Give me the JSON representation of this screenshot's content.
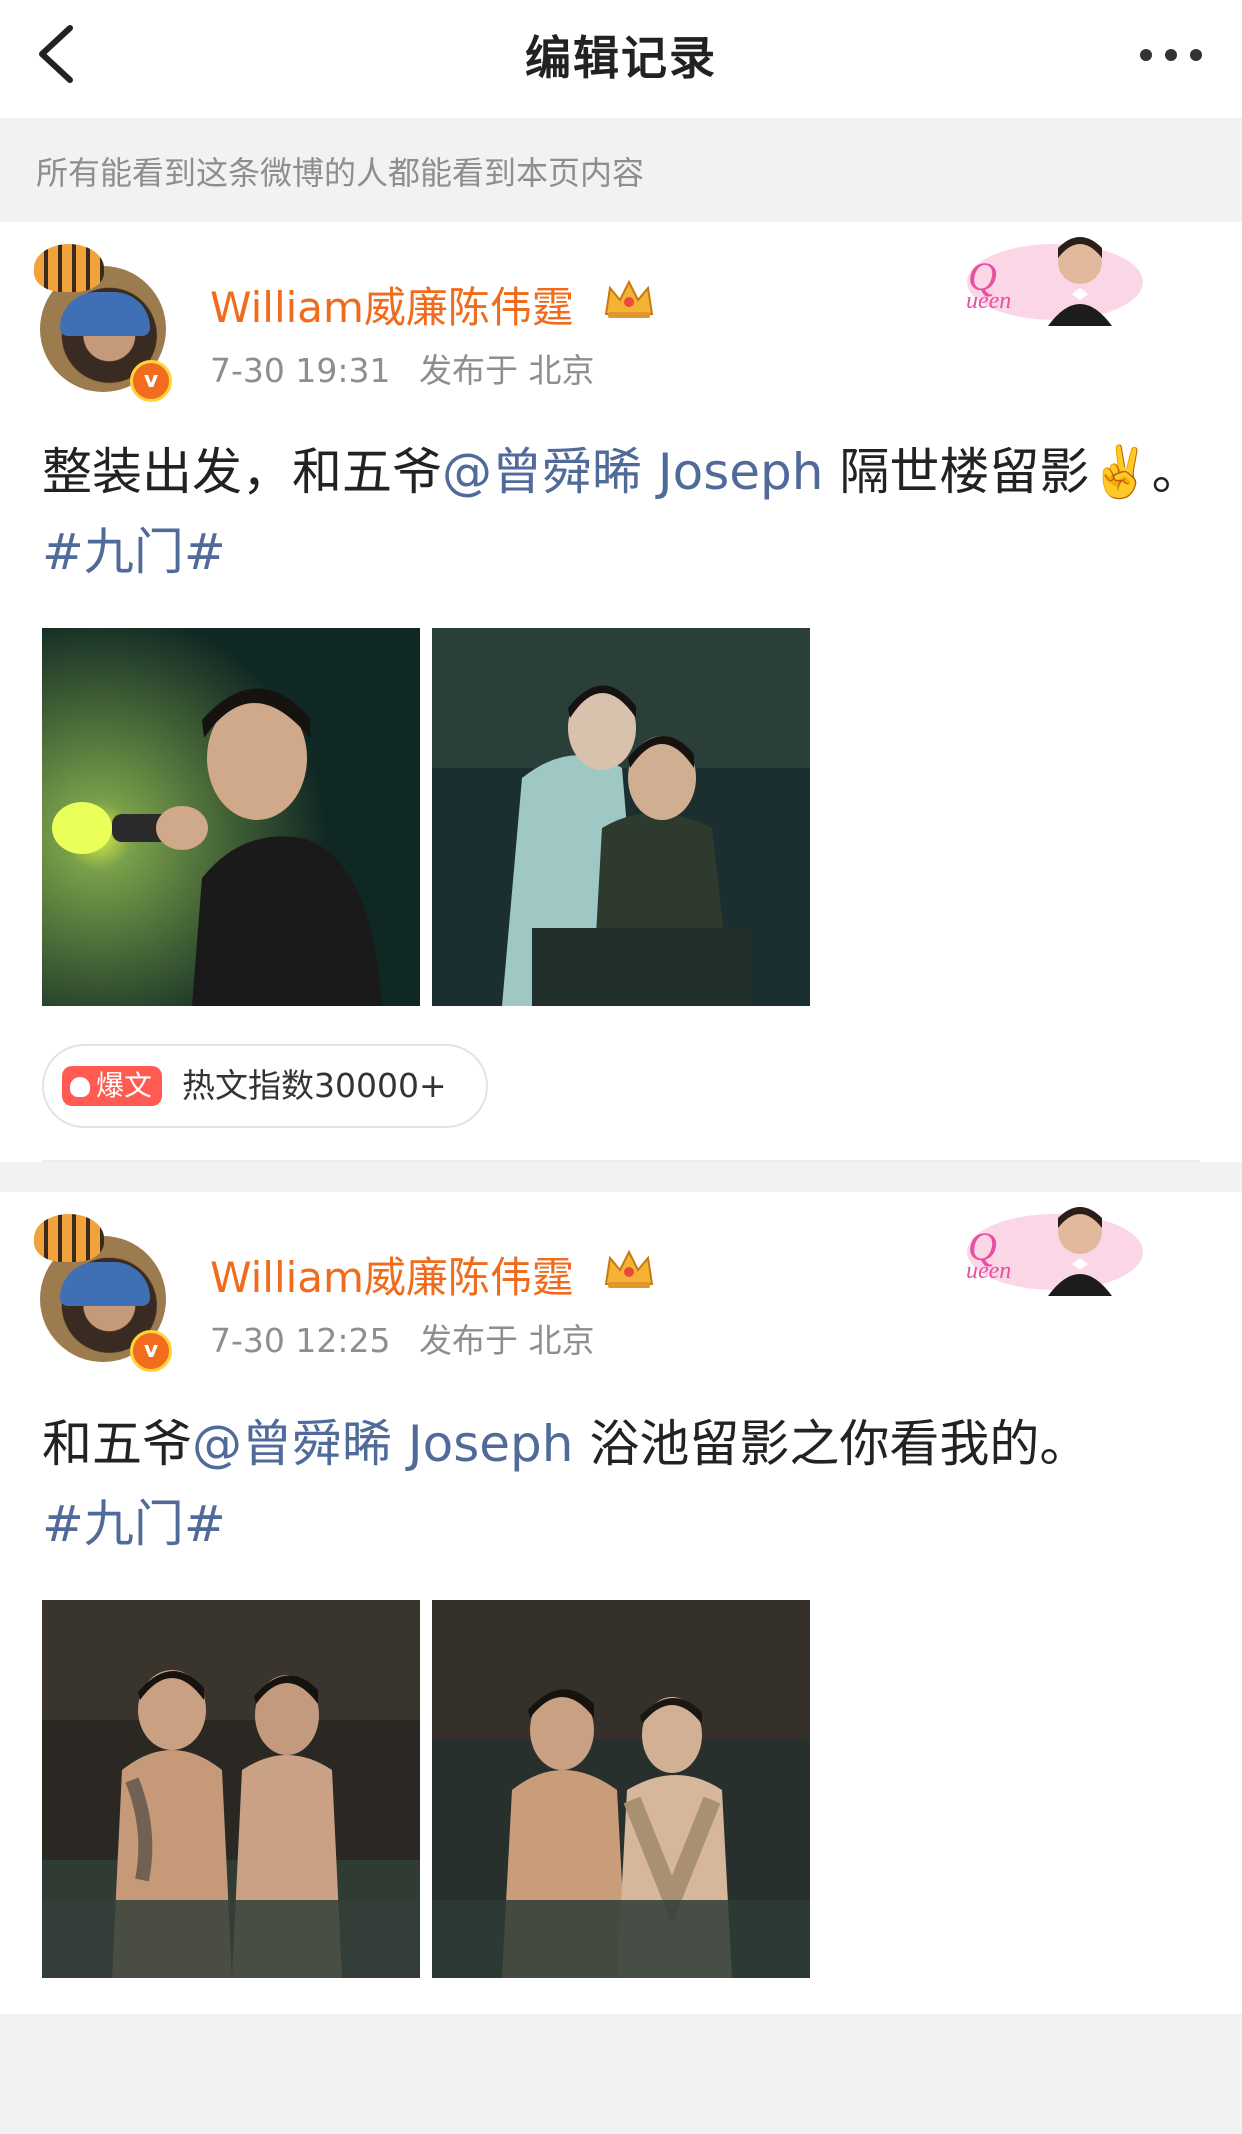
{
  "header": {
    "title": "编辑记录",
    "back_icon": "chevron-left-icon",
    "more_icon": "more-dots-icon"
  },
  "notice": "所有能看到这条微博的人都能看到本页内容",
  "posts": [
    {
      "author": "William威廉陈伟霆",
      "time": "7-30 19:31",
      "location": "发布于 北京",
      "text_1": "整装出发，和五爷",
      "mention": "@曾舜晞 Joseph",
      "text_2": "隔世楼留影✌️。",
      "hashtag": "#九门#",
      "hot_tag": "爆文",
      "hot_text": "热文指数30000+"
    },
    {
      "author": "William威廉陈伟霆",
      "time": "7-30 12:25",
      "location": "发布于 北京",
      "text_1": "和五爷",
      "mention": "@曾舜晞 Joseph",
      "text_2": "浴池留影之你看我的。",
      "hashtag": "#九门#"
    }
  ],
  "colors": {
    "username": "#f06b1b",
    "link": "#506a9a",
    "hot_tag": "#ff5b52",
    "meta": "#8e8e8e"
  }
}
